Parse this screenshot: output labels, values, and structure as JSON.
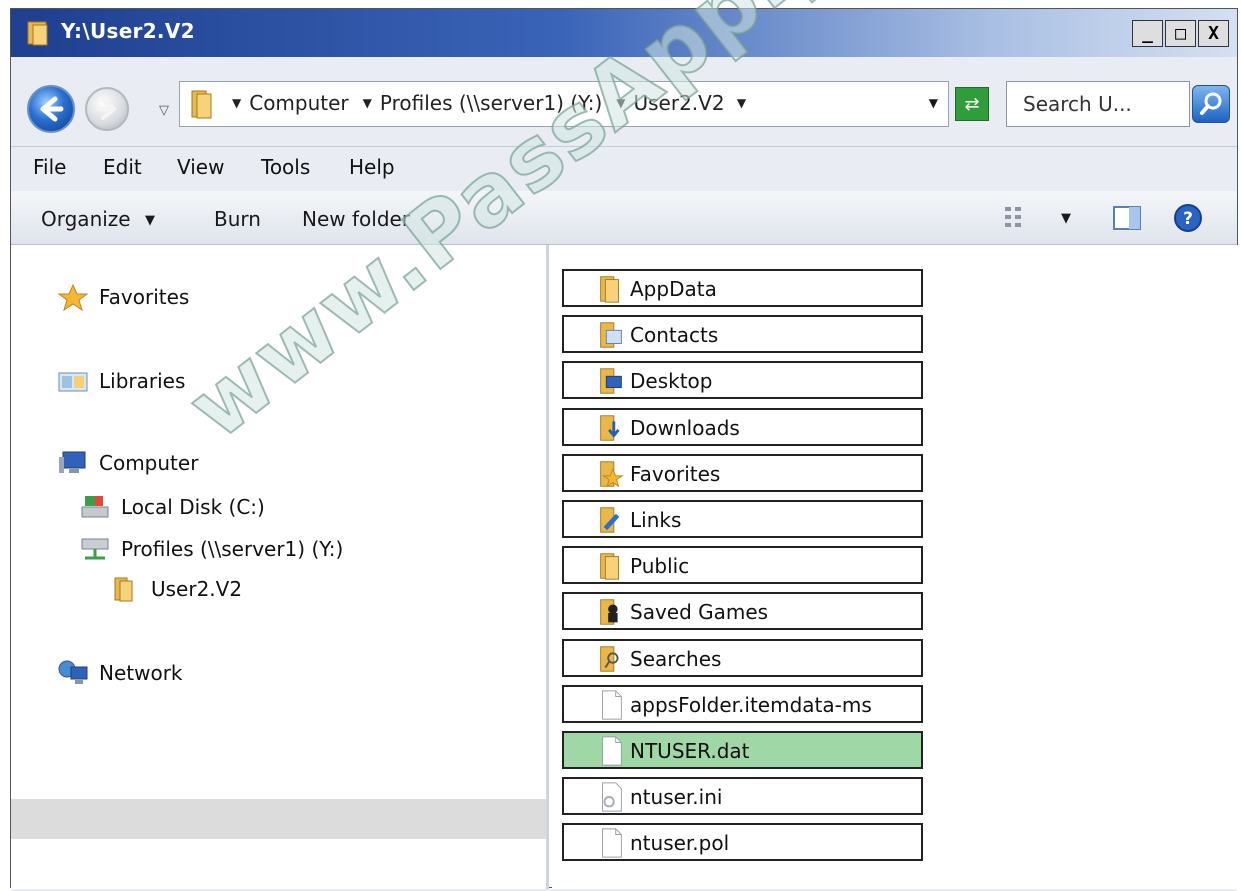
{
  "window": {
    "title": "Y:\\User2.V2",
    "min_label": "_",
    "max_label": "□",
    "close_label": "X"
  },
  "address": {
    "crumbs": [
      "Computer",
      "Profiles (\\\\server1) (Y:)",
      "User2.V2"
    ],
    "search_placeholder": "Search U..."
  },
  "menu": {
    "file": "File",
    "edit": "Edit",
    "view": "View",
    "tools": "Tools",
    "help": "Help"
  },
  "toolbar": {
    "organize": "Organize",
    "burn": "Burn",
    "new_folder": "New folder"
  },
  "nav": {
    "favorites": "Favorites",
    "libraries": "Libraries",
    "computer": "Computer",
    "local_disk": "Local Disk (C:)",
    "profiles": "Profiles (\\\\server1) (Y:)",
    "user": "User2.V2",
    "network": "Network"
  },
  "files": [
    {
      "name": "AppData",
      "icon": "folder-icon",
      "selected": false
    },
    {
      "name": "Contacts",
      "icon": "contacts-folder-icon",
      "selected": false
    },
    {
      "name": "Desktop",
      "icon": "desktop-folder-icon",
      "selected": false
    },
    {
      "name": "Downloads",
      "icon": "downloads-folder-icon",
      "selected": false
    },
    {
      "name": "Favorites",
      "icon": "favorites-folder-icon",
      "selected": false
    },
    {
      "name": "Links",
      "icon": "links-folder-icon",
      "selected": false
    },
    {
      "name": "Public",
      "icon": "folder-icon",
      "selected": false
    },
    {
      "name": "Saved Games",
      "icon": "saved-games-folder-icon",
      "selected": false
    },
    {
      "name": "Searches",
      "icon": "searches-folder-icon",
      "selected": false
    },
    {
      "name": "appsFolder.itemdata-ms",
      "icon": "file-icon",
      "selected": false
    },
    {
      "name": "NTUSER.dat",
      "icon": "file-icon",
      "selected": true
    },
    {
      "name": "ntuser.ini",
      "icon": "settings-file-icon",
      "selected": false
    },
    {
      "name": "ntuser.pol",
      "icon": "file-icon",
      "selected": false
    }
  ],
  "watermark": "www.PassApply.com",
  "colors": {
    "title_start": "#1f3f8f",
    "title_end": "#d4e0f2",
    "selected_file": "#9fd8a6",
    "nav_selected": "#dcdcdc"
  }
}
